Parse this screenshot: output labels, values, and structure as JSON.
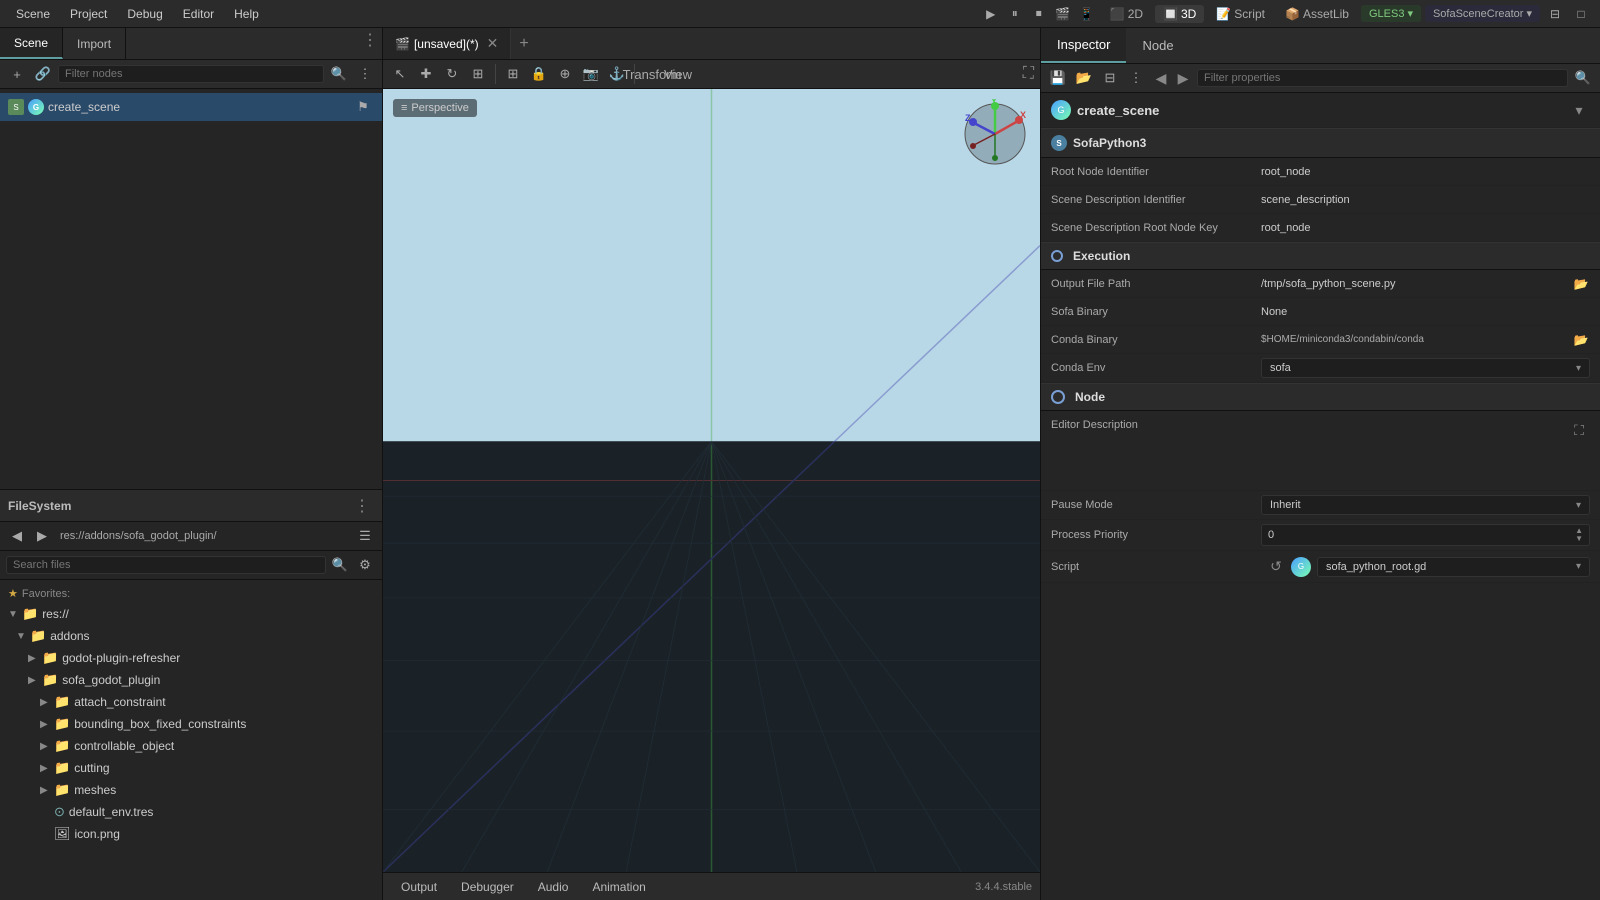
{
  "menubar": {
    "items": [
      "Scene",
      "Project",
      "Debug",
      "Editor",
      "Help"
    ],
    "view2d": "2D",
    "view3d": "3D",
    "script": "Script",
    "assetlib": "AssetLib",
    "gles": "GLES3",
    "scene_creator": "SofaSceneCreator"
  },
  "scene_panel": {
    "tabs": [
      "Scene",
      "Import"
    ],
    "filter_placeholder": "Filter nodes",
    "root_node": "create_scene"
  },
  "filesystem": {
    "title": "FileSystem",
    "path": "res://addons/sofa_godot_plugin/",
    "search_placeholder": "Search files",
    "favorites_label": "Favorites:",
    "tree": [
      {
        "label": "res://",
        "type": "root",
        "indent": 0,
        "expanded": true
      },
      {
        "label": "addons",
        "type": "folder",
        "indent": 1,
        "expanded": true
      },
      {
        "label": "godot-plugin-refresher",
        "type": "folder",
        "indent": 2,
        "expanded": false
      },
      {
        "label": "sofa_godot_plugin",
        "type": "folder",
        "indent": 2,
        "expanded": false
      },
      {
        "label": "attach_constraint",
        "type": "folder",
        "indent": 3,
        "expanded": false
      },
      {
        "label": "bounding_box_fixed_constraints",
        "type": "folder",
        "indent": 3,
        "expanded": false
      },
      {
        "label": "controllable_object",
        "type": "folder",
        "indent": 3,
        "expanded": false
      },
      {
        "label": "cutting",
        "type": "folder",
        "indent": 3,
        "expanded": false
      },
      {
        "label": "meshes",
        "type": "folder",
        "indent": 3,
        "expanded": false
      },
      {
        "label": "default_env.tres",
        "type": "file-env",
        "indent": 3
      },
      {
        "label": "icon.png",
        "type": "file-img",
        "indent": 3
      }
    ]
  },
  "viewport": {
    "tab_label": "[unsaved](*)",
    "perspective_label": "Perspective",
    "tools": [
      "select",
      "move",
      "rotate",
      "scale",
      "snap",
      "lock",
      "transform",
      "pivot",
      "camera",
      "anchor"
    ],
    "transform_btn": "Transform",
    "view_btn": "View",
    "version": "3.4.4.stable"
  },
  "bottom_tabs": [
    "Output",
    "Debugger",
    "Audio",
    "Animation"
  ],
  "inspector": {
    "tabs": [
      "Inspector",
      "Node"
    ],
    "filter_placeholder": "Filter properties",
    "scene_name": "create_scene",
    "plugin_label": "SofaPython3",
    "properties": [
      {
        "label": "Root Node Identifier",
        "value": "root_node"
      },
      {
        "label": "Scene Description Identifier",
        "value": "scene_description"
      },
      {
        "label": "Scene Description Root Node Key",
        "value": "root_node"
      }
    ],
    "execution": {
      "label": "Execution",
      "properties": [
        {
          "label": "Output File Path",
          "value": "/tmp/sofa_python_scene.py",
          "has_folder": true
        },
        {
          "label": "Sofa Binary",
          "value": "None"
        },
        {
          "label": "Conda Binary",
          "value": "$HOME/miniconda3/condabin/conda",
          "has_folder": true
        },
        {
          "label": "Conda Env",
          "value": "sofa",
          "has_dropdown": true
        }
      ]
    },
    "node_section": {
      "label": "Node",
      "properties": [
        {
          "label": "Editor Description",
          "value": ""
        },
        {
          "label": "Pause Mode",
          "value": "Inherit",
          "has_dropdown": true
        },
        {
          "label": "Process Priority",
          "value": "0",
          "has_stepper": true
        }
      ]
    },
    "script_label": "Script",
    "script_value": "sofa_python_root.gd"
  }
}
